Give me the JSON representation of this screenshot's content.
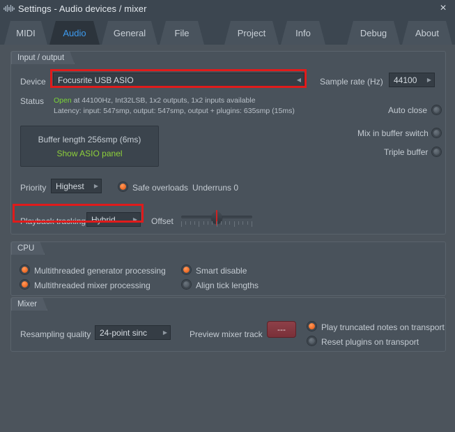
{
  "window": {
    "title": "Settings - Audio devices / mixer",
    "icon": "waveform-icon",
    "close_label": "×"
  },
  "tabs": {
    "left": [
      {
        "label": "MIDI",
        "active": false
      },
      {
        "label": "Audio",
        "active": true
      },
      {
        "label": "General",
        "active": false
      },
      {
        "label": "File",
        "active": false
      }
    ],
    "middle": [
      {
        "label": "Project",
        "active": false
      },
      {
        "label": "Info",
        "active": false
      }
    ],
    "right": [
      {
        "label": "Debug",
        "active": false
      },
      {
        "label": "About",
        "active": false
      }
    ]
  },
  "input_output": {
    "group_label": "Input / output",
    "device_label": "Device",
    "device_value": "Focusrite USB ASIO",
    "sample_rate_label": "Sample rate (Hz)",
    "sample_rate_value": "44100",
    "status_label": "Status",
    "status_open": "Open",
    "status_line1_rest": " at 44100Hz, Int32LSB, 1x2 outputs, 1x2 inputs available",
    "status_line2": "Latency: input: 547smp, output: 547smp, output + plugins: 635smp (15ms)",
    "auto_close_label": "Auto close",
    "auto_close_state": "off",
    "buffer_length_label": "Buffer length 256smp (6ms)",
    "show_asio_panel_label": "Show ASIO panel",
    "mix_in_buffer_switch_label": "Mix in buffer switch",
    "mix_in_buffer_switch_state": "off",
    "triple_buffer_label": "Triple buffer",
    "triple_buffer_state": "off",
    "priority_label": "Priority",
    "priority_value": "Highest",
    "safe_overloads_label": "Safe overloads",
    "safe_overloads_state": "on",
    "underruns_label": "Underruns 0",
    "playback_tracking_label": "Playback tracking",
    "playback_tracking_value": "Hybrid",
    "offset_label": "Offset",
    "offset_value": "0"
  },
  "cpu": {
    "group_label": "CPU",
    "items": [
      {
        "label": "Multithreaded generator processing",
        "state": "on"
      },
      {
        "label": "Multithreaded mixer processing",
        "state": "on"
      },
      {
        "label": "Smart disable",
        "state": "on"
      },
      {
        "label": "Align tick lengths",
        "state": "off"
      }
    ]
  },
  "mixer": {
    "group_label": "Mixer",
    "resampling_label": "Resampling quality",
    "resampling_value": "24-point sinc",
    "preview_track_label": "Preview mixer track",
    "preview_track_value": "---",
    "play_truncated_label": "Play truncated notes on transport",
    "play_truncated_state": "on",
    "reset_plugins_label": "Reset plugins on transport",
    "reset_plugins_state": "off"
  },
  "annotations": {
    "highlight_color": "#e01b1b",
    "highlighted": [
      "device_value",
      "playback_tracking"
    ]
  }
}
